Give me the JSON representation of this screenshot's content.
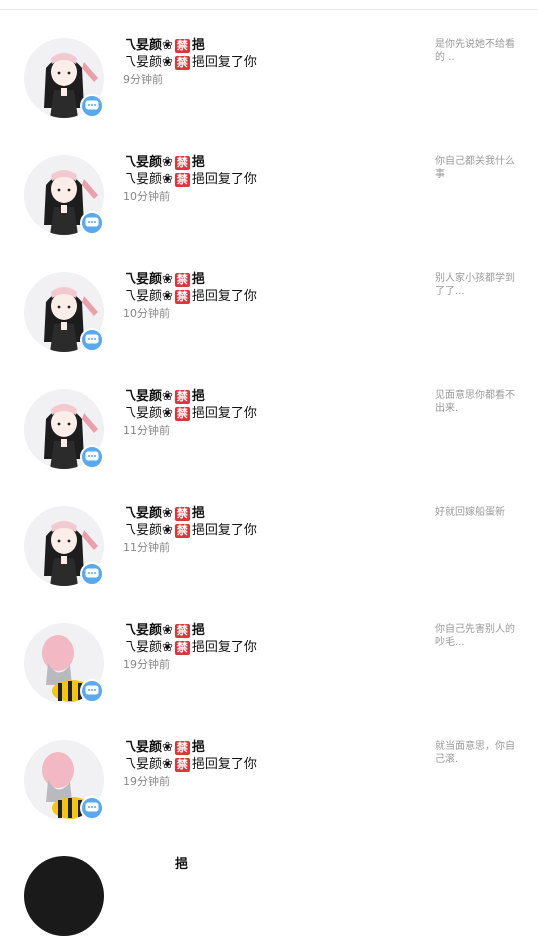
{
  "ban_badge": "禁",
  "accent_color": "#5aa9ee",
  "items": [
    {
      "nick_a": "乁妟颜❀",
      "nick_b": "挹",
      "line2_a": "乁妟颜❀",
      "line2_b": "挹回复了你",
      "time": "9分钟前",
      "preview": "是你先说她不给看的\n..",
      "avatar": "girl-bow"
    },
    {
      "nick_a": "乁妟颜❀",
      "nick_b": "挹",
      "line2_a": "乁妟颜❀",
      "line2_b": "挹回复了你",
      "time": "10分钟前",
      "preview": "你自己都关我什么事",
      "avatar": "girl-bow"
    },
    {
      "nick_a": "乁妟颜❀",
      "nick_b": "挹",
      "line2_a": "乁妟颜❀",
      "line2_b": "挹回复了你",
      "time": "10分钟前",
      "preview": "别人家小孩都学到了了...",
      "avatar": "girl-bow"
    },
    {
      "nick_a": "乁妟颜❀",
      "nick_b": "挹",
      "line2_a": "乁妟颜❀",
      "line2_b": "挹回复了你",
      "time": "11分钟前",
      "preview": "见面意思你都看不出来.",
      "avatar": "girl-bow"
    },
    {
      "nick_a": "乁妟颜❀",
      "nick_b": "挹",
      "line2_a": "乁妟颜❀",
      "line2_b": "挹回复了你",
      "time": "11分钟前",
      "preview": "好就回嫁船蛋新",
      "avatar": "girl-bow"
    },
    {
      "nick_a": "乁妟颜❀",
      "nick_b": "挹",
      "line2_a": "乁妟颜❀",
      "line2_b": "挹回复了你",
      "time": "19分钟前",
      "preview": "你自己先害别人的吵毛...",
      "avatar": "girl-bee"
    },
    {
      "nick_a": "乁妟颜❀",
      "nick_b": "挹",
      "line2_a": "乁妟颜❀",
      "line2_b": "挹回复了你",
      "time": "19分钟前",
      "preview": "就当面意思，你自己滚.",
      "avatar": "girl-bee"
    }
  ],
  "peek": {
    "text": "挹"
  }
}
